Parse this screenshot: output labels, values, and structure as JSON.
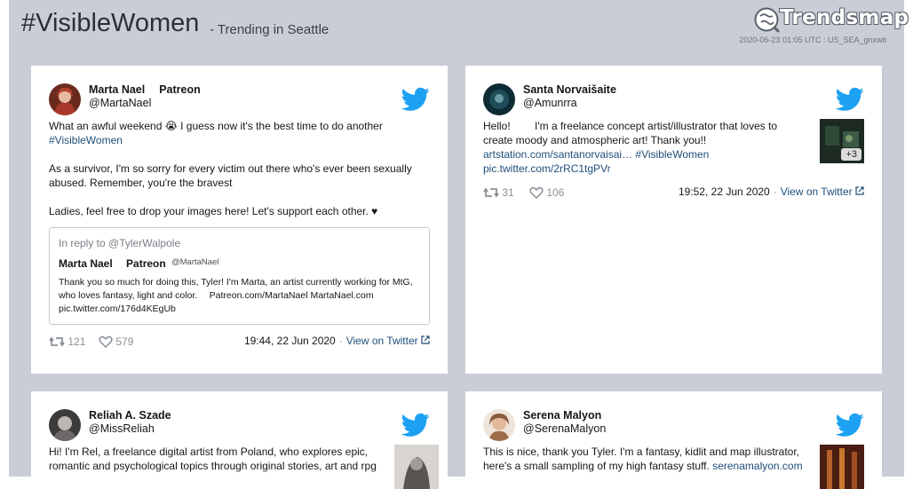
{
  "header": {
    "title": "#VisibleWomen",
    "subtitle": "- Trending in Seattle",
    "brand": "Trendsmap",
    "timestamp": "2020-06-23 01:05 UTC : US_SEA_gnxwti"
  },
  "colors": {
    "background": "#c9cdd6",
    "twitter_blue": "#1da1f2",
    "link": "#1f4e79"
  },
  "tweets": [
    {
      "name": "Marta Nael  Patreon ",
      "handle": "@MartaNael",
      "lines": [
        "What an awful weekend 😭 I guess now it's the best time to do another",
        "#VisibleWomen",
        "As a survivor, I'm so sorry for every victim out there who's ever been sexually abused. Remember, you're the bravest  ",
        "Ladies, feel free to drop your images here! Let's support each other. ♥"
      ],
      "quote": {
        "reply_to": "In reply to @TylerWalpole",
        "name": "Marta Nael  Patreon ",
        "handle": "@MartaNael",
        "text": "Thank you so much for doing this, Tyler! I'm Marta, an artist currently working for MtG, who loves fantasy, light and color.  Patreon.com/MartaNael MartaNael.com pic.twitter.com/176d4KEgUb"
      },
      "retweets": "121",
      "likes": "579",
      "date": "19:44, 22 Jun 2020",
      "view_on_twitter": "View on Twitter"
    },
    {
      "name": "Santa Norvaišaite",
      "handle": "@Amunrra",
      "lines": [
        "Hello!   I'm a freelance concept artist/illustrator that loves to create moody and atmospheric art! Thank you!!  ",
        "artstation.com/santanorvaisai… #VisibleWomen",
        "pic.twitter.com/2rRC1tgPVr"
      ],
      "media_count": "+3",
      "retweets": "31",
      "likes": "106",
      "date": "19:52, 22 Jun 2020",
      "view_on_twitter": "View on Twitter"
    },
    {
      "name": "Reliah A. Szade",
      "handle": "@MissReliah",
      "lines": [
        "Hi! I'm Rel, a freelance digital artist from Poland, who explores epic, romantic and psychological topics through original stories, art and rpg"
      ]
    },
    {
      "name": "Serena Malyon   ",
      "handle": "@SerenaMalyon",
      "lines": [
        "This is nice, thank you Tyler. I'm a fantasy, kidlit and map illustrator, here's a small sampling of my high fantasy stuff.",
        "serenamalyon.com"
      ]
    }
  ]
}
